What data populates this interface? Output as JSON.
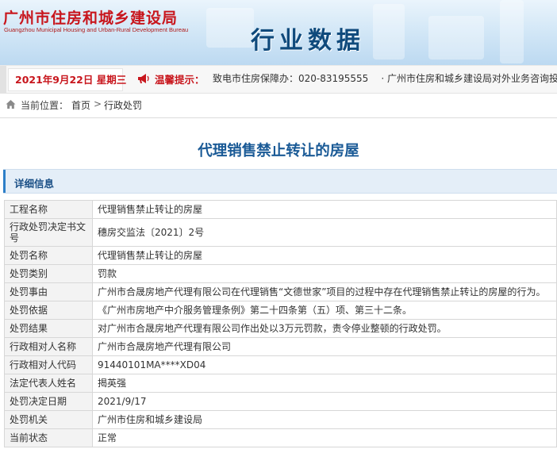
{
  "header": {
    "logo_cn": "广州市住房和城乡建设局",
    "logo_en": "Guangzhou Municipal Housing and Urban-Rural Development Bureau",
    "section_title": "行业数据"
  },
  "info_bar": {
    "date": "2021年9月22日 星期三",
    "notice_label": "温馨提示：",
    "notices": [
      "致电市住房保障办：020-83195555",
      "· 广州市住房和城乡建设局对外业务咨询投诉"
    ]
  },
  "breadcrumb": {
    "prefix": "当前位置：",
    "home": "首页",
    "separator": ">",
    "current": "行政处罚"
  },
  "page_title": "代理销售禁止转让的房屋",
  "detail_section_label": "详细信息",
  "details": [
    {
      "label": "工程名称",
      "value": "代理销售禁止转让的房屋"
    },
    {
      "label": "行政处罚决定书文号",
      "value": "穗房交监法〔2021〕2号"
    },
    {
      "label": "处罚名称",
      "value": "代理销售禁止转让的房屋"
    },
    {
      "label": "处罚类别",
      "value": "罚款"
    },
    {
      "label": "处罚事由",
      "value": "广州市合晟房地产代理有限公司在代理销售“文德世家”项目的过程中存在代理销售禁止转让的房屋的行为。"
    },
    {
      "label": "处罚依据",
      "value": "《广州市房地产中介服务管理条例》第二十四条第（五）项、第三十二条。"
    },
    {
      "label": "处罚结果",
      "value": "对广州市合晟房地产代理有限公司作出处以3万元罚款，责令停业整顿的行政处罚。"
    },
    {
      "label": "行政相对人名称",
      "value": "广州市合晟房地产代理有限公司"
    },
    {
      "label": "行政相对人代码",
      "value": "91440101MA****XD04"
    },
    {
      "label": "法定代表人姓名",
      "value": "揭英强"
    },
    {
      "label": "处罚决定日期",
      "value": "2021/9/17"
    },
    {
      "label": "处罚机关",
      "value": "广州市住房和城乡建设局"
    },
    {
      "label": "当前状态",
      "value": "正常"
    }
  ],
  "colors": {
    "brand_red": "#c8161d",
    "title_blue": "#1a5a96",
    "banner_navy": "#0f4a7c",
    "detail_bar_bg": "#e4eef8"
  },
  "icons": {
    "horn": "megaphone-icon",
    "home": "home-icon"
  }
}
